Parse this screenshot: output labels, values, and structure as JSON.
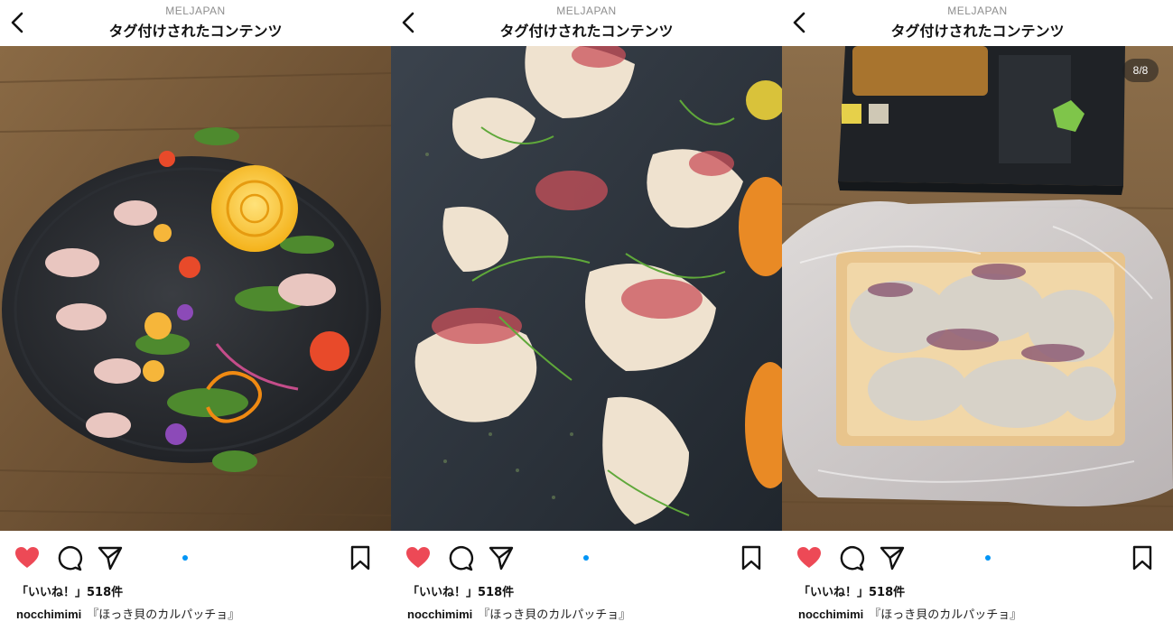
{
  "accent_color": "#0095f6",
  "heart_color": "#ed4956",
  "panels": [
    {
      "header": {
        "account": "MELJAPAN",
        "title": "タグ付けされたコンテンツ"
      },
      "photo": {
        "subject": "carpaccio-plate"
      },
      "likes": "「いいね！」518件",
      "caption": {
        "user": "nocchimimi",
        "text": "『ほっき貝のカルパッチョ』"
      }
    },
    {
      "header": {
        "account": "MELJAPAN",
        "title": "タグ付けされたコンテンツ"
      },
      "photo": {
        "subject": "surf-clam-closeup"
      },
      "likes": "「いいね！」518件",
      "caption": {
        "user": "nocchimimi",
        "text": "『ほっき貝のカルパッチョ』"
      }
    },
    {
      "header": {
        "account": "MELJAPAN",
        "title": "タグ付けされたコンテンツ"
      },
      "photo": {
        "subject": "packaged-product",
        "counter": "8/8"
      },
      "likes": "「いいね！」518件",
      "caption": {
        "user": "nocchimimi",
        "text": "『ほっき貝のカルパッチョ』"
      }
    }
  ],
  "icons": {
    "back": "chevron-left-icon",
    "like": "heart-filled-icon",
    "comment": "comment-bubble-icon",
    "share": "paper-plane-icon",
    "save": "bookmark-icon"
  }
}
